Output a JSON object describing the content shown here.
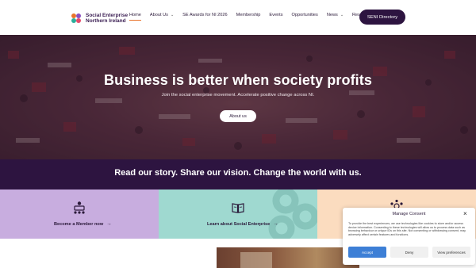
{
  "header": {
    "logo": {
      "line1": "Social Enterprise",
      "line2": "Northern Ireland"
    },
    "nav": [
      {
        "label": "Home",
        "active": true
      },
      {
        "label": "About Us",
        "dropdown": true
      },
      {
        "label": "SE Awards for NI 2026"
      },
      {
        "label": "Membership"
      },
      {
        "label": "Events"
      },
      {
        "label": "Opportunities"
      },
      {
        "label": "News",
        "dropdown": true
      },
      {
        "label": "Resources"
      }
    ],
    "cta": "SENI Directory"
  },
  "hero": {
    "title": "Business is better when society profits",
    "subtitle": "Join the social enterprise movement. Accelerate positive change across NI.",
    "button": "About us"
  },
  "tagline": "Read our story. Share our vision. Change the world with us.",
  "cards": [
    {
      "label": "Become a Member now",
      "icon": "members-icon",
      "color": "#c8addf"
    },
    {
      "label": "Learn about Social Enterprise",
      "icon": "book-icon",
      "color": "#9fd9d0"
    },
    {
      "label": "",
      "icon": "network-icon",
      "color": "#fbdcbf"
    }
  ],
  "consent": {
    "title": "Manage Consent",
    "text": "To provide the best experiences, we use technologies like cookies to store and/or access device information. Consenting to these technologies will allow us to process data such as browsing behaviour or unique IDs on this site. Not consenting or withdrawing consent, may adversely affect certain features and functions.",
    "accept": "Accept",
    "deny": "Deny",
    "preferences": "View preferences"
  },
  "colors": {
    "brand_dark": "#2d1440",
    "accent_orange": "#e8742c",
    "accept_blue": "#3d7fd6"
  }
}
